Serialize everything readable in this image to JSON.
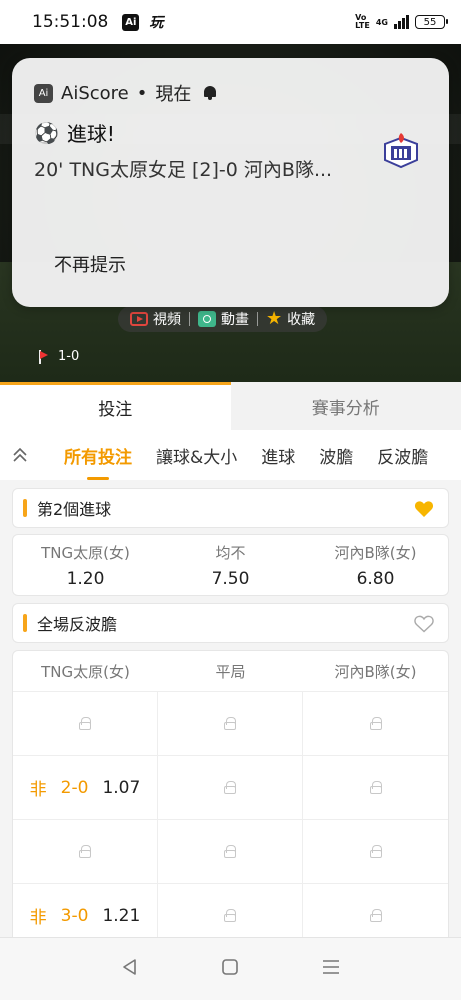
{
  "status_bar": {
    "time": "15:51:08",
    "app1": "Ai",
    "app2": "玩",
    "volte": "Vo LTE",
    "network": "4G",
    "battery": "55"
  },
  "notification": {
    "app_icon": "Ai",
    "app_name": "AiScore",
    "separator": "•",
    "time": "現在",
    "title": "進球!",
    "body": "20' TNG太原女足 [2]-0 河內B隊...",
    "action": "不再提示"
  },
  "match": {
    "media": [
      {
        "icon": "video-icon",
        "label": "視頻"
      },
      {
        "icon": "animation-icon",
        "label": "動畫"
      },
      {
        "icon": "star-icon",
        "label": "收藏"
      }
    ],
    "score": "1-0"
  },
  "main_tabs": [
    {
      "label": "投注",
      "active": true
    },
    {
      "label": "賽事分析",
      "active": false
    }
  ],
  "sub_tabs": [
    {
      "label": "所有投注",
      "active": true
    },
    {
      "label": "讓球&大小",
      "active": false
    },
    {
      "label": "進球",
      "active": false
    },
    {
      "label": "波膽",
      "active": false
    },
    {
      "label": "反波膽",
      "active": false
    }
  ],
  "markets": {
    "next_goal": {
      "title": "第2個進球",
      "favorited": true,
      "home": {
        "label": "TNG太原(女)",
        "odds": "1.20"
      },
      "draw": {
        "label": "均不",
        "odds": "7.50"
      },
      "away": {
        "label": "河內B隊(女)",
        "odds": "6.80"
      }
    },
    "anti_correct_score": {
      "title": "全場反波膽",
      "favorited": false,
      "headers": [
        "TNG太原(女)",
        "平局",
        "河內B隊(女)"
      ],
      "rows": [
        {
          "home_tag": "",
          "home_line": "",
          "home_odds": ""
        },
        {
          "home_tag": "非",
          "home_line": "2-0",
          "home_odds": "1.07"
        },
        {
          "home_tag": "",
          "home_line": "",
          "home_odds": ""
        },
        {
          "home_tag": "非",
          "home_line": "3-0",
          "home_odds": "1.21"
        }
      ]
    }
  },
  "colors": {
    "accent": "#f39a00",
    "heart_filled": "#f7b500"
  }
}
